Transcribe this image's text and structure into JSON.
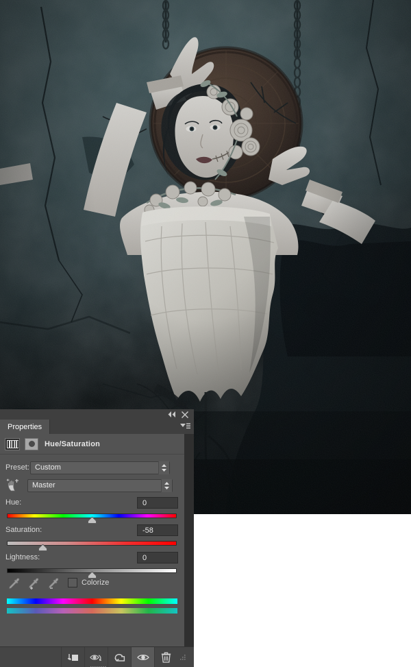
{
  "window": {
    "collapse_icon": "double-chevron-left-icon",
    "close_icon": "close-x-icon",
    "menu_icon": "panel-menu-icon"
  },
  "panel": {
    "tab_label": "Properties",
    "adjustment": {
      "icon": "hue-saturation-adjustment-icon",
      "mask_icon": "layer-mask-thumbnail-icon",
      "title": "Hue/Saturation"
    },
    "preset": {
      "label": "Preset:",
      "value": "Custom",
      "spinner_icon": "spinner-updown-icon"
    },
    "targeted_adjust": {
      "icon": "on-image-adjustment-hand-icon"
    },
    "channel": {
      "value": "Master",
      "spinner_icon": "spinner-updown-icon"
    },
    "sliders": [
      {
        "name": "hue",
        "label": "Hue:",
        "value": "0",
        "thumb_pct": 50,
        "track": "hue-spectrum"
      },
      {
        "name": "saturation",
        "label": "Saturation:",
        "value": "-58",
        "thumb_pct": 21,
        "track": "saturation-gradient"
      },
      {
        "name": "lightness",
        "label": "Lightness:",
        "value": "0",
        "thumb_pct": 50,
        "track": "lightness-gradient"
      }
    ],
    "eyedroppers": [
      {
        "name": "eyedropper-sample",
        "icon": "eyedropper-icon"
      },
      {
        "name": "eyedropper-add",
        "icon": "eyedropper-plus-icon"
      },
      {
        "name": "eyedropper-subtract",
        "icon": "eyedropper-minus-icon"
      }
    ],
    "colorize": {
      "label": "Colorize",
      "checked": false
    },
    "color_bars": {
      "top_name": "color-range-bar-original",
      "bottom_name": "color-range-bar-adjusted"
    },
    "footer": [
      {
        "name": "clip-to-layer-button",
        "icon": "clip-to-layer-icon",
        "active": false
      },
      {
        "name": "toggle-previous-state-button",
        "icon": "eye-previous-state-icon",
        "active": false
      },
      {
        "name": "reset-button",
        "icon": "reset-arrow-icon",
        "active": false
      },
      {
        "name": "toggle-visibility-button",
        "icon": "eye-icon",
        "active": true
      },
      {
        "name": "delete-button",
        "icon": "trash-icon",
        "active": false
      },
      {
        "name": "resize-grip",
        "icon": "resize-grip-icon",
        "active": false
      }
    ]
  },
  "colors": {
    "panel_bg": "#535353",
    "panel_chrome": "#3f3f3f",
    "footer_bg": "#454545",
    "text": "#d6d6d6",
    "field_bg": "#3c3c3c",
    "combo_bg": "#5e5e5e"
  },
  "canvas": {
    "name": "photo-canvas",
    "description": "dark teal cracked concrete wall with suspended woman in pale dress, chains, ornate round plate, grey roses"
  }
}
